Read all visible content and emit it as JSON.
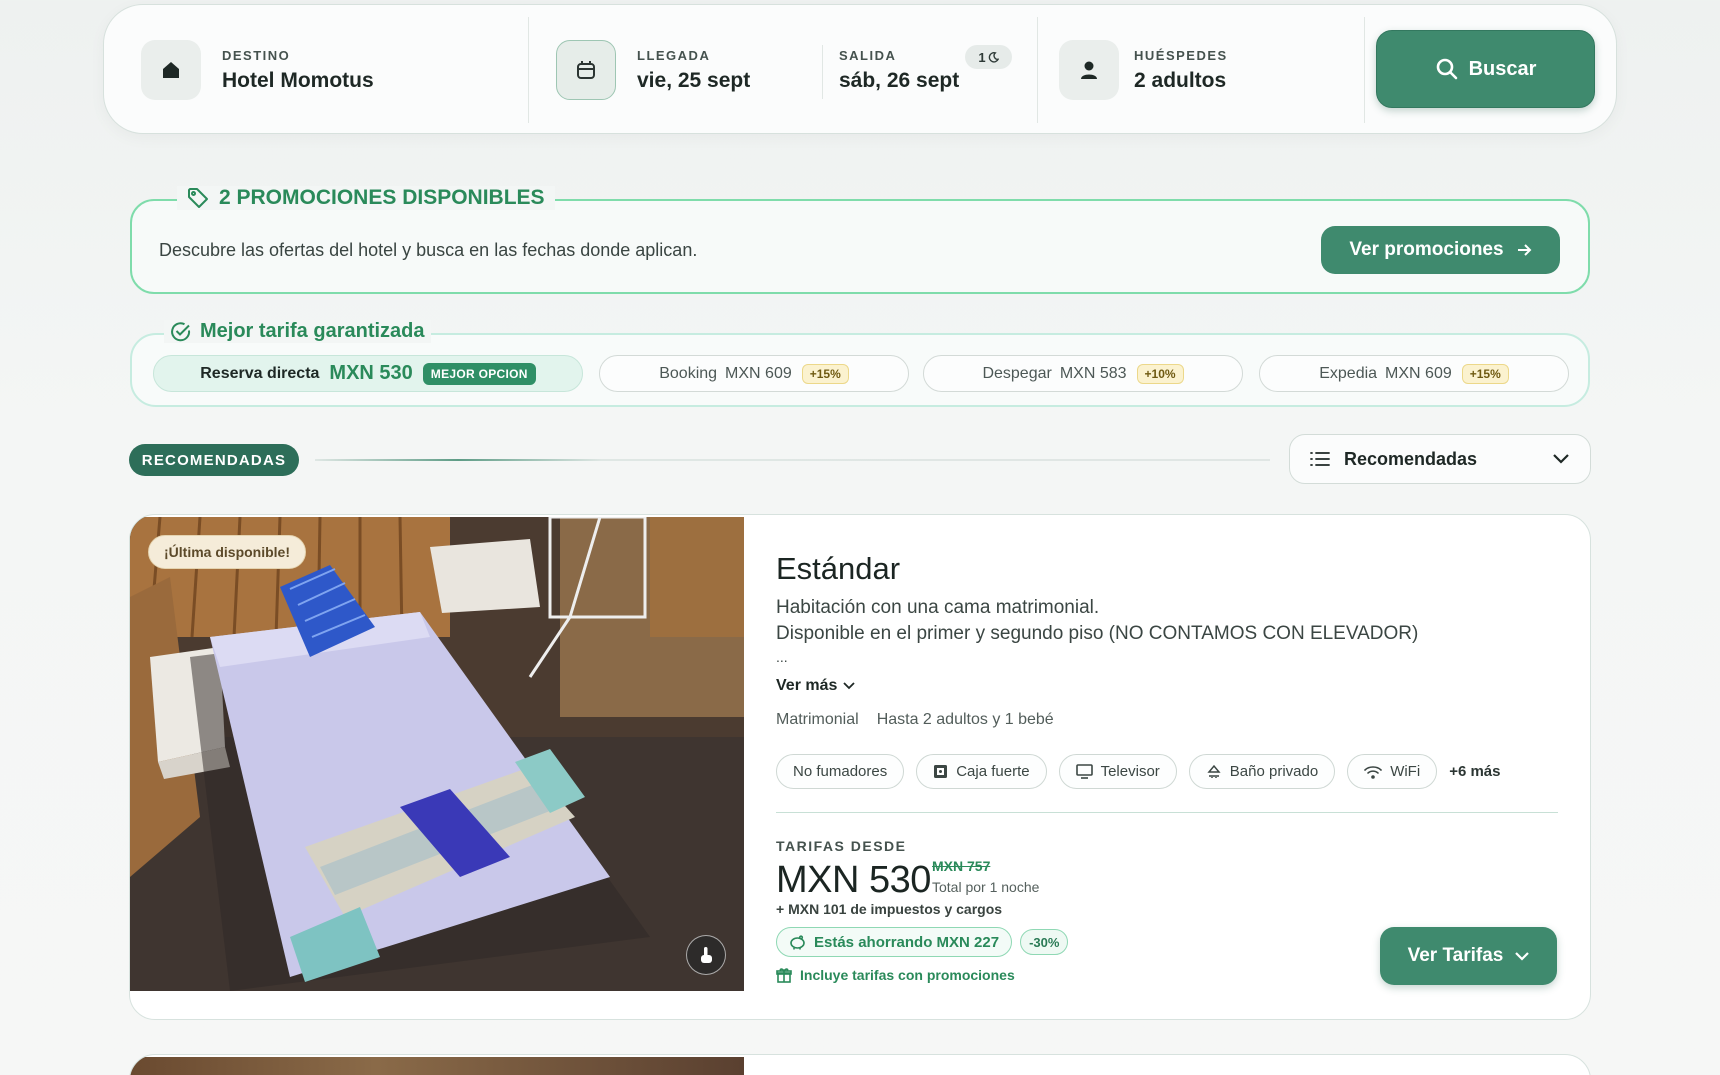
{
  "search": {
    "destino_label": "DESTINO",
    "destino_value": "Hotel Momotus",
    "llegada_label": "LLEGADA",
    "llegada_value": "vie, 25 sept",
    "salida_label": "SALIDA",
    "salida_value": "sáb, 26 sept",
    "nights_count": "1",
    "huespedes_label": "HUÉSPEDES",
    "huespedes_value": "2 adultos",
    "search_button": "Buscar",
    "icons": {
      "destino": "home-icon",
      "dates": "calendar-icon",
      "guests": "user-icon",
      "search": "search-icon",
      "nights": "moon-icon"
    }
  },
  "promo": {
    "title": "2 PROMOCIONES DISPONIBLES",
    "description": "Descubre las ofertas del hotel y busca en las fechas donde aplican.",
    "button": "Ver promociones",
    "icon": "tag-icon"
  },
  "best_rate": {
    "title": "Mejor tarifa garantizada",
    "direct": {
      "label": "Reserva directa",
      "price": "MXN 530",
      "badge": "MEJOR OPCION"
    },
    "others": [
      {
        "name": "Booking",
        "price": "MXN 609",
        "pct": "+15%"
      },
      {
        "name": "Despegar",
        "price": "MXN 583",
        "pct": "+10%"
      },
      {
        "name": "Expedia",
        "price": "MXN 609",
        "pct": "+15%"
      }
    ]
  },
  "section": {
    "badge": "RECOMENDADAS",
    "sort_value": "Recomendadas"
  },
  "room": {
    "tag": "¡Última disponible!",
    "title": "Estándar",
    "desc_line1": "Habitación con una cama matrimonial.",
    "desc_line2": "Disponible en el primer y segundo piso (NO CONTAMOS CON ELEVADOR)",
    "ellipsis": "...",
    "ver_mas": "Ver más",
    "bed": "Matrimonial",
    "capacity": "Hasta 2 adultos y 1 bebé",
    "amenities": [
      "No fumadores",
      "Caja fuerte",
      "Televisor",
      "Baño privado",
      "WiFi"
    ],
    "amenities_more": "+6 más",
    "rates_label": "TARIFAS DESDE",
    "price": "MXN 530",
    "price_old": "MXN 757",
    "price_total": "Total por 1 noche",
    "taxes": "+ MXN 101 de impuestos y cargos",
    "saving": "Estás ahorrando MXN 227",
    "saving_pct": "-30%",
    "includes": "Incluye tarifas con promociones",
    "button": "Ver Tarifas"
  },
  "colors": {
    "primary": "#3f8a6e",
    "accent_green": "#2a8a5a",
    "promo_border": "#7fdcab",
    "section_badge": "#2d6e59"
  }
}
